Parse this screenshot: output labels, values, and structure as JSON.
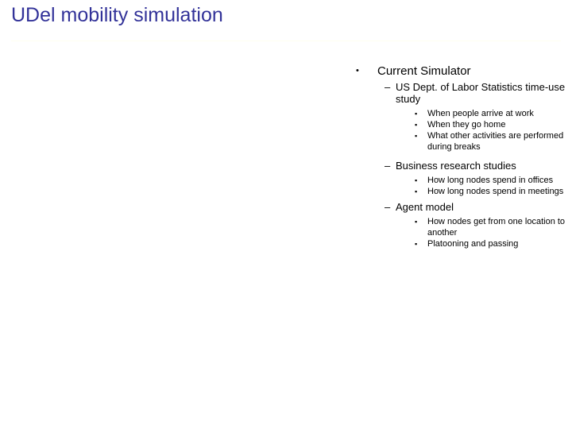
{
  "slide": {
    "title": "UDel mobility simulation",
    "title_color": "#333399",
    "body_color": "#000000",
    "background": "#ffffff",
    "rule_color": "#fffff0"
  },
  "markers": {
    "level1": "•",
    "level2": "–",
    "level3": "▪"
  },
  "outline": {
    "level1": {
      "label": "Current Simulator"
    },
    "sections": [
      {
        "label": "US Dept. of Labor Statistics time-use study",
        "items": [
          "When people arrive at work",
          "When they go home",
          "What other activities are performed during breaks"
        ]
      },
      {
        "label": "Business research studies",
        "items": [
          "How long nodes spend in offices",
          "How long nodes spend in meetings"
        ]
      },
      {
        "label": "Agent model",
        "items": [
          "How nodes get from one location to another",
          "Platooning and passing"
        ]
      }
    ]
  }
}
